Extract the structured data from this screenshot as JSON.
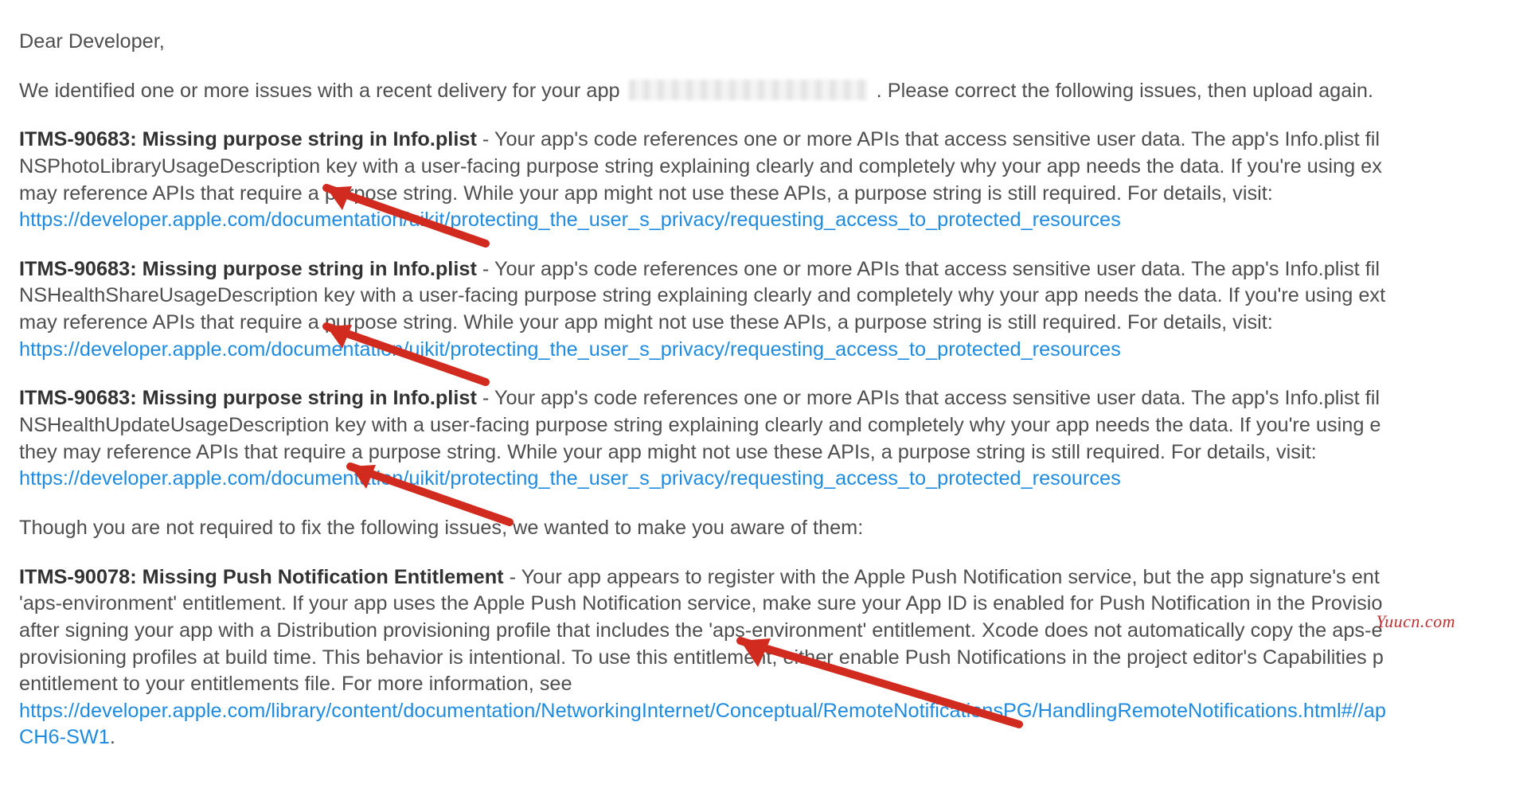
{
  "greeting": "Dear Developer,",
  "intro": {
    "before_blur": "We identified one or more issues with a recent delivery for your app  ",
    "after_blur": ". Please correct the following issues, then upload again."
  },
  "issues": [
    {
      "title": "ITMS-90683: Missing purpose string in Info.plist",
      "body_line1": " - Your app's code references one or more APIs that access sensitive user data. The app's Info.plist fil",
      "body_line2": "NSPhotoLibraryUsageDescription key with a user-facing purpose string explaining clearly and completely why your app needs the data. If you're using ex",
      "body_line3": "may reference APIs that require a purpose string. While your app might not use these APIs, a purpose string is still required. For details, visit:",
      "link": "https://developer.apple.com/documentation/uikit/protecting_the_user_s_privacy/requesting_access_to_protected_resources"
    },
    {
      "title": "ITMS-90683: Missing purpose string in Info.plist",
      "body_line1": " - Your app's code references one or more APIs that access sensitive user data. The app's Info.plist fil",
      "body_line2": "NSHealthShareUsageDescription key with a user-facing purpose string explaining clearly and completely why your app needs the data. If you're using ext",
      "body_line3": "may reference APIs that require a purpose string. While your app might not use these APIs, a purpose string is still required. For details, visit:",
      "link": "https://developer.apple.com/documentation/uikit/protecting_the_user_s_privacy/requesting_access_to_protected_resources"
    },
    {
      "title": "ITMS-90683: Missing purpose string in Info.plist",
      "body_line1": " - Your app's code references one or more APIs that access sensitive user data. The app's Info.plist fil",
      "body_line2": "NSHealthUpdateUsageDescription key with a user-facing purpose string explaining clearly and completely why your app needs the data. If you're using e",
      "body_line3": "they may reference APIs that require a purpose string. While your app might not use these APIs, a purpose string is still required. For details, visit:",
      "link": "https://developer.apple.com/documentation/uikit/protecting_the_user_s_privacy/requesting_access_to_protected_resources"
    }
  ],
  "notice": "Though you are not required to fix the following issues, we wanted to make you aware of them:",
  "push_issue": {
    "title": "ITMS-90078: Missing Push Notification Entitlement",
    "body_line1": " - Your app appears to register with the Apple Push Notification service, but the app signature's ent",
    "body_line2": "'aps-environment' entitlement. If your app uses the Apple Push Notification service, make sure your App ID is enabled for Push Notification in the Provisio",
    "body_line3": "after signing your app with a Distribution provisioning profile that includes the 'aps-environment' entitlement. Xcode does not automatically copy the aps-e",
    "body_line4": "provisioning profiles at build time. This behavior is intentional. To use this entitlement, either enable Push Notifications in the project editor's Capabilities p",
    "body_line5": "entitlement to your entitlements file. For more information, see",
    "link_line1": "https://developer.apple.com/library/content/documentation/NetworkingInternet/Conceptual/RemoteNotificationsPG/HandlingRemoteNotifications.html#//ap",
    "link_line2": "CH6-SW1",
    "link_trail": "."
  },
  "watermark": "Yuucn.com"
}
